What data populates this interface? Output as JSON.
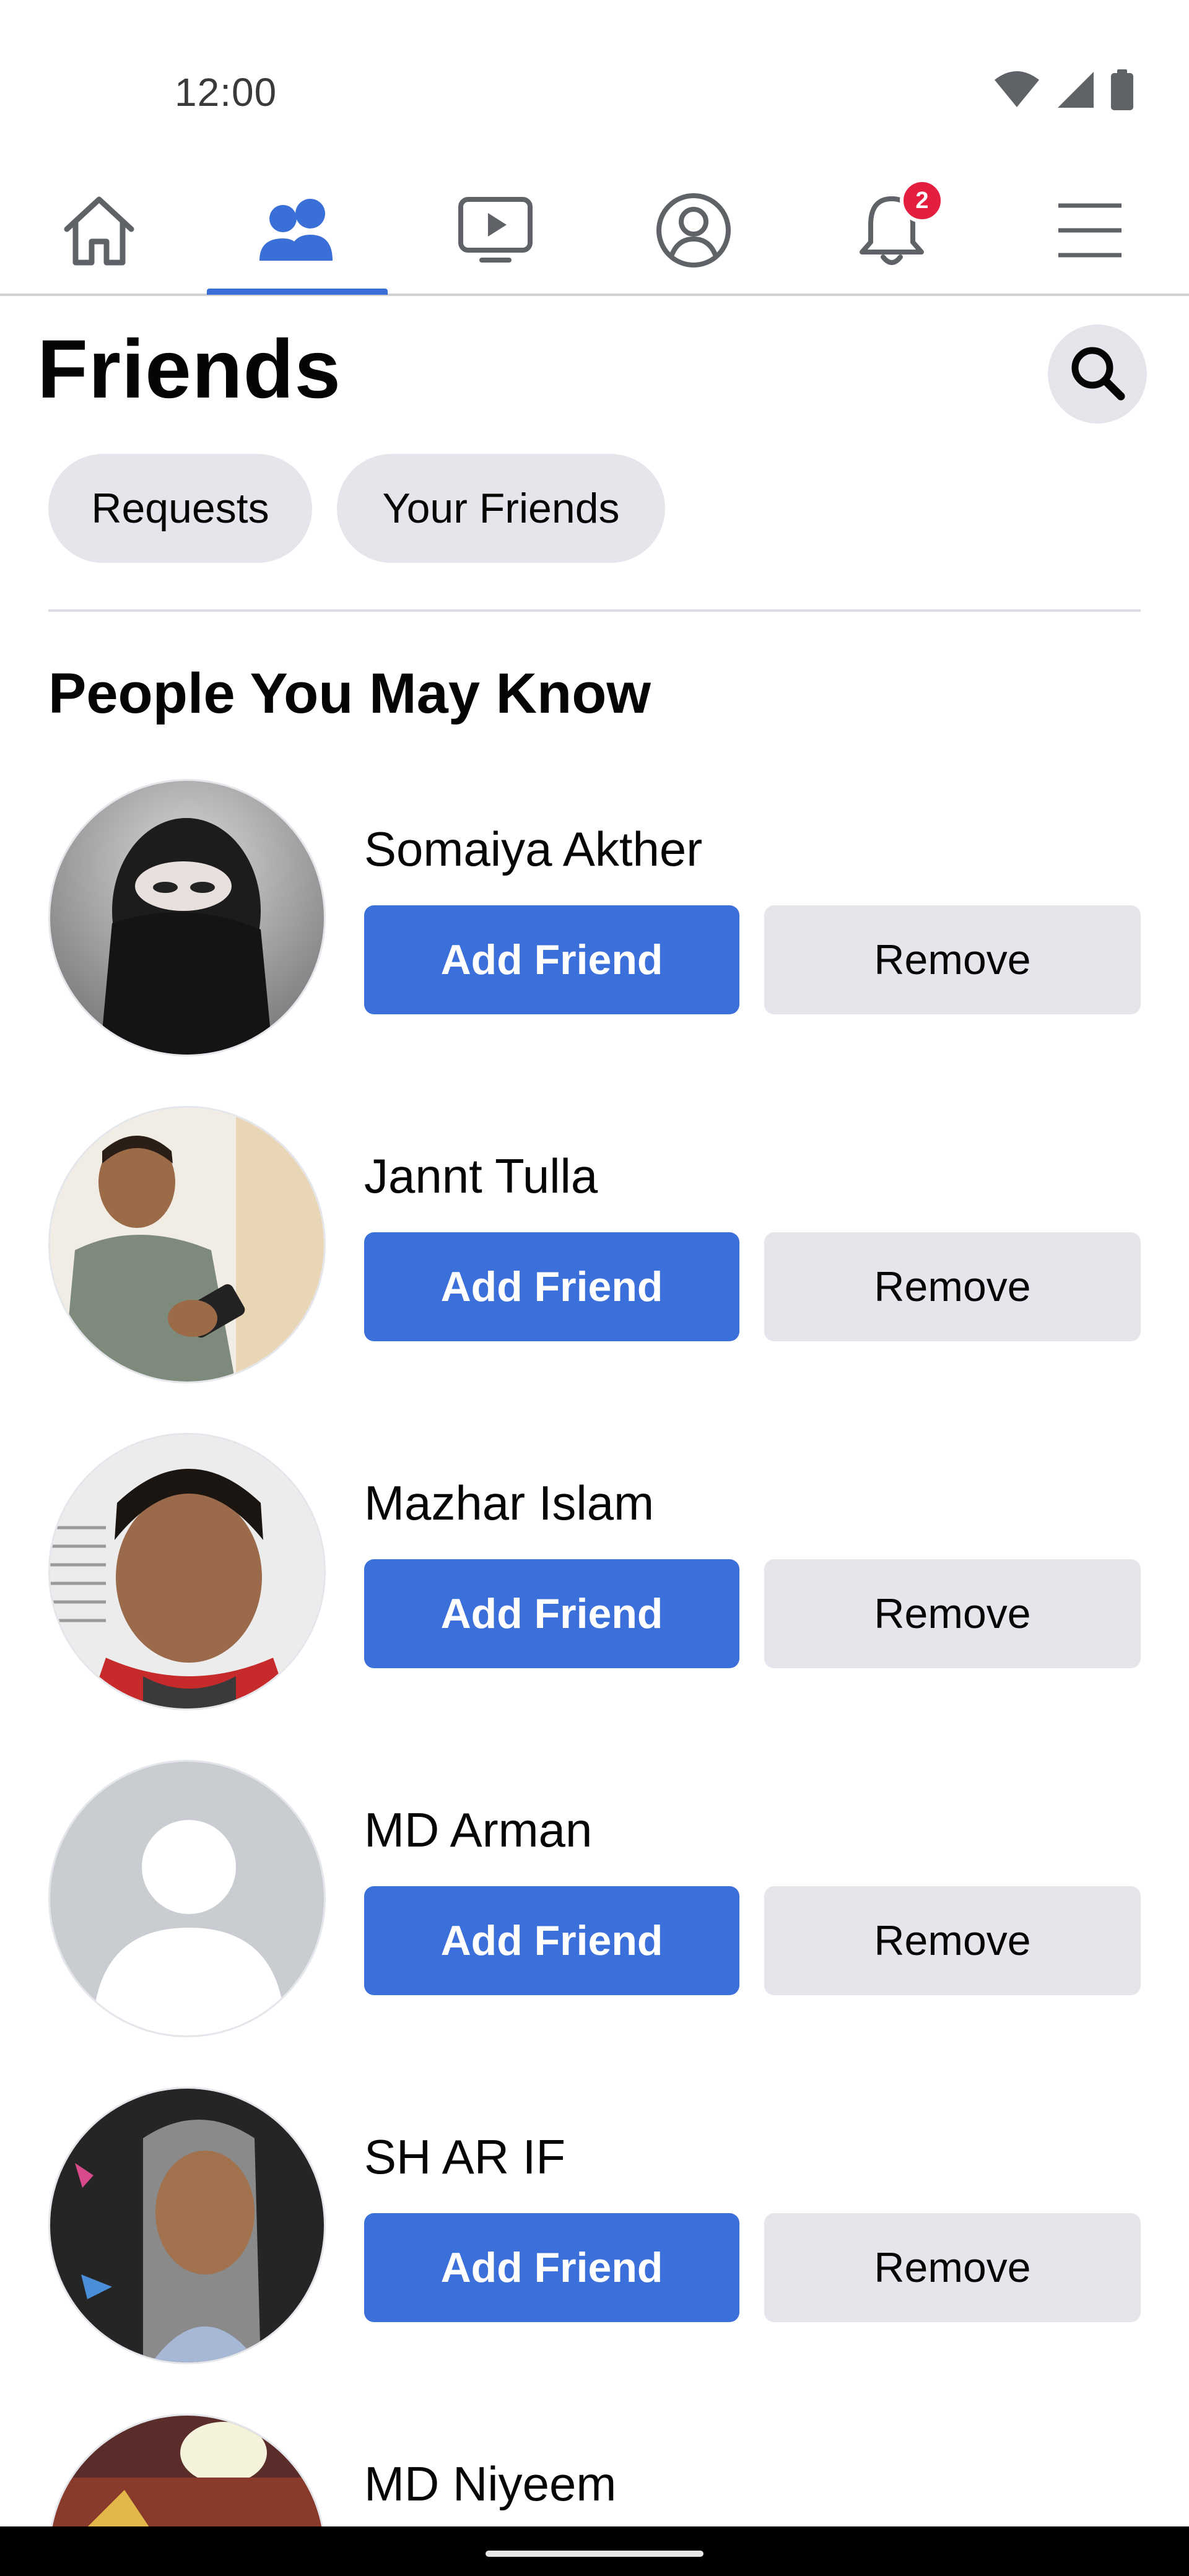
{
  "status_bar": {
    "time": "12:00",
    "icons": [
      "wifi-icon",
      "cell-signal-icon",
      "battery-icon"
    ]
  },
  "nav": {
    "items": [
      {
        "icon": "home-icon",
        "active": false
      },
      {
        "icon": "friends-icon",
        "active": true
      },
      {
        "icon": "watch-video-icon",
        "active": false
      },
      {
        "icon": "profile-icon",
        "active": false
      },
      {
        "icon": "notifications-bell-icon",
        "active": false,
        "badge": "2"
      },
      {
        "icon": "menu-icon",
        "active": false
      }
    ],
    "accent_color": "#3a6fd8",
    "badge_color": "#e41e3f"
  },
  "header": {
    "title": "Friends",
    "search_icon": "search-icon"
  },
  "chips": {
    "requests": "Requests",
    "your_friends": "Your Friends"
  },
  "section": {
    "title": "People You May Know"
  },
  "people": [
    {
      "name": "Somaiya Akther",
      "add_label": "Add Friend",
      "remove_label": "Remove"
    },
    {
      "name": "Jannt Tulla",
      "add_label": "Add Friend",
      "remove_label": "Remove"
    },
    {
      "name": "Mazhar Islam",
      "add_label": "Add Friend",
      "remove_label": "Remove"
    },
    {
      "name": "MD Arman",
      "add_label": "Add Friend",
      "remove_label": "Remove"
    },
    {
      "name": "SH AR IF",
      "add_label": "Add Friend",
      "remove_label": "Remove"
    },
    {
      "name": "MD Niyeem"
    }
  ],
  "colors": {
    "primary_button": "#3b6fd9",
    "secondary_button": "#e4e6eb"
  }
}
